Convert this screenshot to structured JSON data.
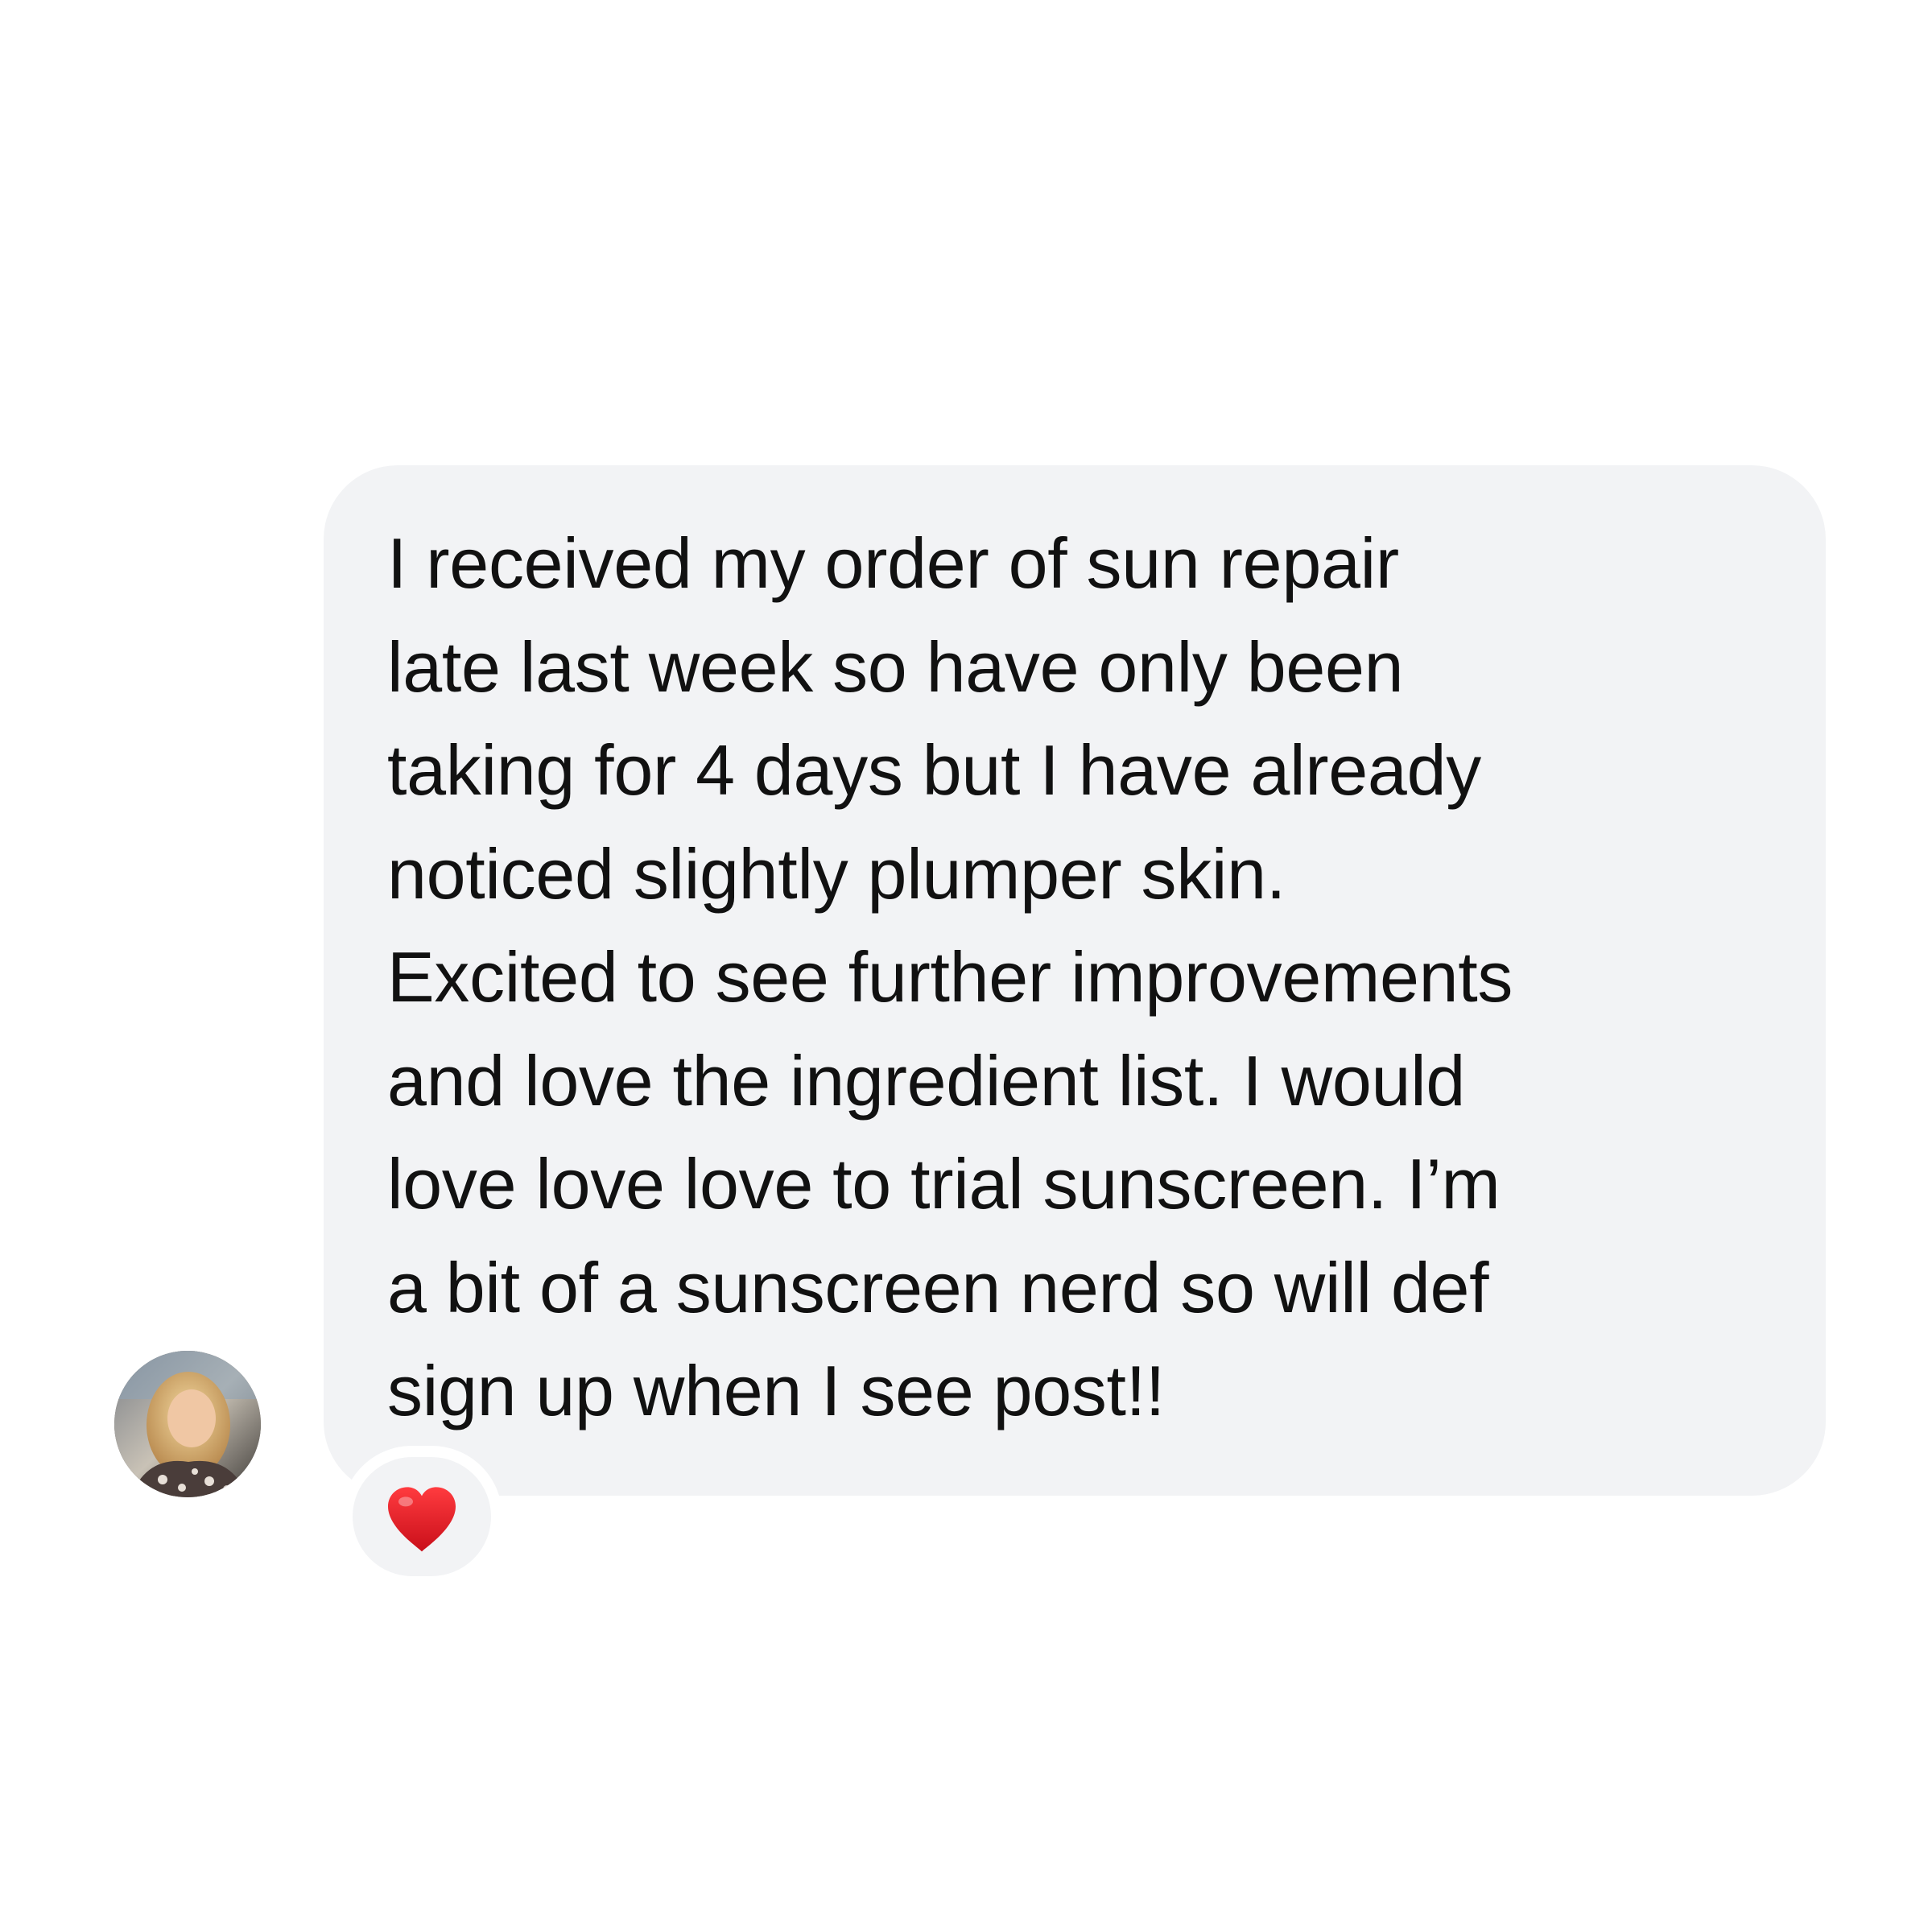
{
  "message": {
    "lines": [
      "I received my order of sun repair",
      "late last week so have only been",
      "taking for 4 days but I have already",
      "noticed slightly plumper skin.",
      "Excited to see further improvements",
      "and love the ingredient list. I would",
      "love love love to trial sunscreen. I’m",
      "a bit of a sunscreen nerd so will def",
      "sign up when I see post!!"
    ]
  },
  "reaction": {
    "icon": "red-heart",
    "color": "#e0141f"
  },
  "colors": {
    "bubble": "#f2f3f5",
    "text": "#111111",
    "background": "#ffffff"
  }
}
